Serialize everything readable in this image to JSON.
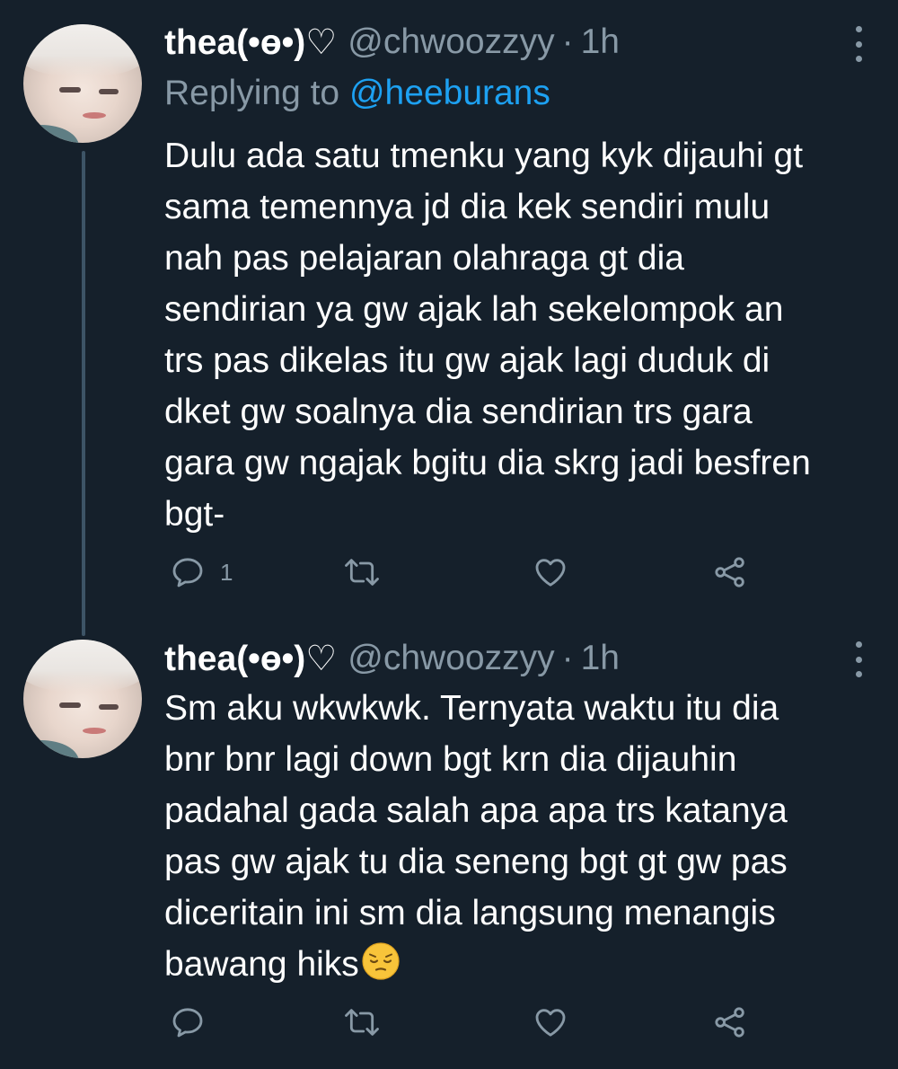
{
  "colors": {
    "background": "#15202b",
    "primary_text": "#ffffff",
    "secondary_text": "#8899a6",
    "link": "#1da1f2",
    "thread_line": "#3d5466"
  },
  "tweets": [
    {
      "display_name": "thea(•ɵ•)♡",
      "handle": "@chwoozzyy",
      "separator": "·",
      "time": "1h",
      "replying_prefix": "Replying to",
      "replying_to": "@heeburans",
      "lines": [
        "Dulu ada satu tmenku yang kyk dijauhi gt",
        "sama temennya jd dia kek sendiri mulu",
        "nah pas pelajaran olahraga gt dia",
        "sendirian ya gw ajak lah sekelompok an",
        "trs pas dikelas itu gw ajak lagi duduk di",
        "dket gw soalnya dia sendirian trs gara",
        "gara gw ngajak bgitu dia skrg jadi besfren",
        "bgt-"
      ],
      "reply_count": "1",
      "icons": [
        "reply-icon",
        "retweet-icon",
        "like-icon",
        "share-icon",
        "more-icon"
      ]
    },
    {
      "display_name": "thea(•ɵ•)♡",
      "handle": "@chwoozzyy",
      "separator": "·",
      "time": "1h",
      "lines": [
        "Sm aku wkwkwk. Ternyata waktu itu dia",
        "bnr bnr lagi down bgt krn dia dijauhin",
        "padahal gada salah apa apa trs katanya",
        "pas gw ajak tu dia seneng bgt gt gw pas",
        "diceritain ini sm dia langsung menangis",
        "bawang hiks"
      ],
      "trailing_emoji": "pensive-face-emoji",
      "reply_count": "",
      "icons": [
        "reply-icon",
        "retweet-icon",
        "like-icon",
        "share-icon",
        "more-icon"
      ]
    }
  ]
}
